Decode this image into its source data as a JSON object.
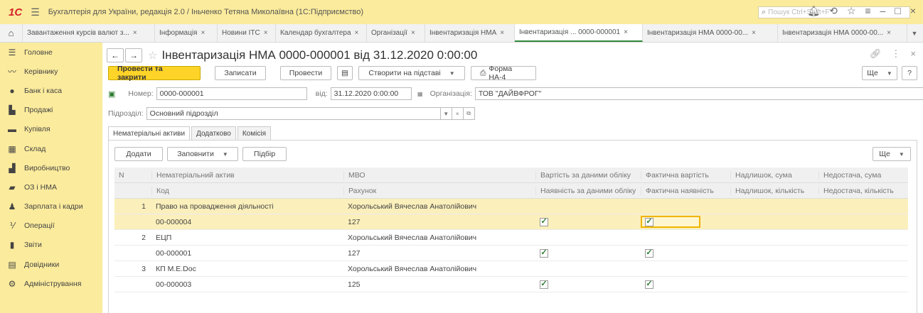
{
  "app": {
    "logo": "1С",
    "title": "Бухгалтерія для України, редакція 2.0 / Іньченко Тетяна Миколаївна (1С:Підприємство)",
    "search_placeholder": "Пошук Ctrl+Shift+F"
  },
  "tabs": [
    {
      "label": "Завантаження курсів валют з..."
    },
    {
      "label": "Інформація"
    },
    {
      "label": "Новини ITC"
    },
    {
      "label": "Календар бухгалтера"
    },
    {
      "label": "Організації"
    },
    {
      "label": "Інвентаризація НМА"
    },
    {
      "label": "Інвентаризація ... 0000-000001"
    },
    {
      "label": "Інвентаризація НМА 0000-00..."
    },
    {
      "label": "Інвентаризація НМА 0000-00..."
    }
  ],
  "sidebar": {
    "items": [
      {
        "label": "Головне",
        "icon": "menu-icon"
      },
      {
        "label": "Керівнику",
        "icon": "chart-icon"
      },
      {
        "label": "Банк і каса",
        "icon": "bank-icon"
      },
      {
        "label": "Продажі",
        "icon": "cart-icon"
      },
      {
        "label": "Купівля",
        "icon": "truck-icon"
      },
      {
        "label": "Склад",
        "icon": "warehouse-icon"
      },
      {
        "label": "Виробництво",
        "icon": "factory-icon"
      },
      {
        "label": "ОЗ і НМА",
        "icon": "assets-icon"
      },
      {
        "label": "Зарплата і кадри",
        "icon": "person-icon"
      },
      {
        "label": "Операції",
        "icon": "operations-icon"
      },
      {
        "label": "Звіти",
        "icon": "reports-icon"
      },
      {
        "label": "Довідники",
        "icon": "book-icon"
      },
      {
        "label": "Адміністрування",
        "icon": "gear-icon"
      }
    ]
  },
  "doc": {
    "title": "Інвентаризація НМА 0000-000001 від 31.12.2020 0:00:00",
    "toolbar": {
      "post_close": "Провести та закрити",
      "save": "Записати",
      "post": "Провести",
      "create_based": "Створити на підставі",
      "form": "Форма НА-4",
      "more": "Ще",
      "help": "?"
    },
    "number_label": "Номер:",
    "number": "0000-000001",
    "date_label": "від:",
    "date": "31.12.2020 0:00:00",
    "org_label": "Організація:",
    "org": "ТОВ \"ДАЙВФРОГ\"",
    "dept_label": "Підрозділ:",
    "dept": "Основний підрозділ"
  },
  "subtabs": [
    "Нематеріальні активи",
    "Додатково",
    "Комісія"
  ],
  "table_toolbar": {
    "add": "Додати",
    "fill": "Заповнити",
    "select": "Підбір",
    "more": "Ще"
  },
  "table": {
    "headers_top": [
      "N",
      "Нематеріальний актив",
      "МВО",
      "Вартість за даними обліку",
      "Фактична вартість",
      "Надлишок, сума",
      "Недостача, сума"
    ],
    "headers_bottom": [
      "",
      "Код",
      "Рахунок",
      "Наявність за даними обліку",
      "Фактична наявність",
      "Надлишок, кількість",
      "Недостача, кількість"
    ],
    "rows": [
      {
        "n": "1",
        "asset": "Право на провадження діяльності",
        "code": "00-000004",
        "mvo": "Хорольський Вячеслав Анатолійович",
        "account": "127",
        "book_presence": true,
        "actual_presence": true
      },
      {
        "n": "2",
        "asset": "ЕЦП",
        "code": "00-000001",
        "mvo": "Хорольський Вячеслав Анатолійович",
        "account": "127",
        "book_presence": true,
        "actual_presence": true
      },
      {
        "n": "3",
        "asset": "КП M.E.Doc",
        "code": "00-000003",
        "mvo": "Хорольський Вячеслав Анатолійович",
        "account": "125",
        "book_presence": true,
        "actual_presence": true
      }
    ]
  },
  "colors": {
    "accent": "#fbeb9c",
    "primary_button": "#ffd428",
    "selected_row": "#fbefbb",
    "check": "#2e7d32"
  }
}
